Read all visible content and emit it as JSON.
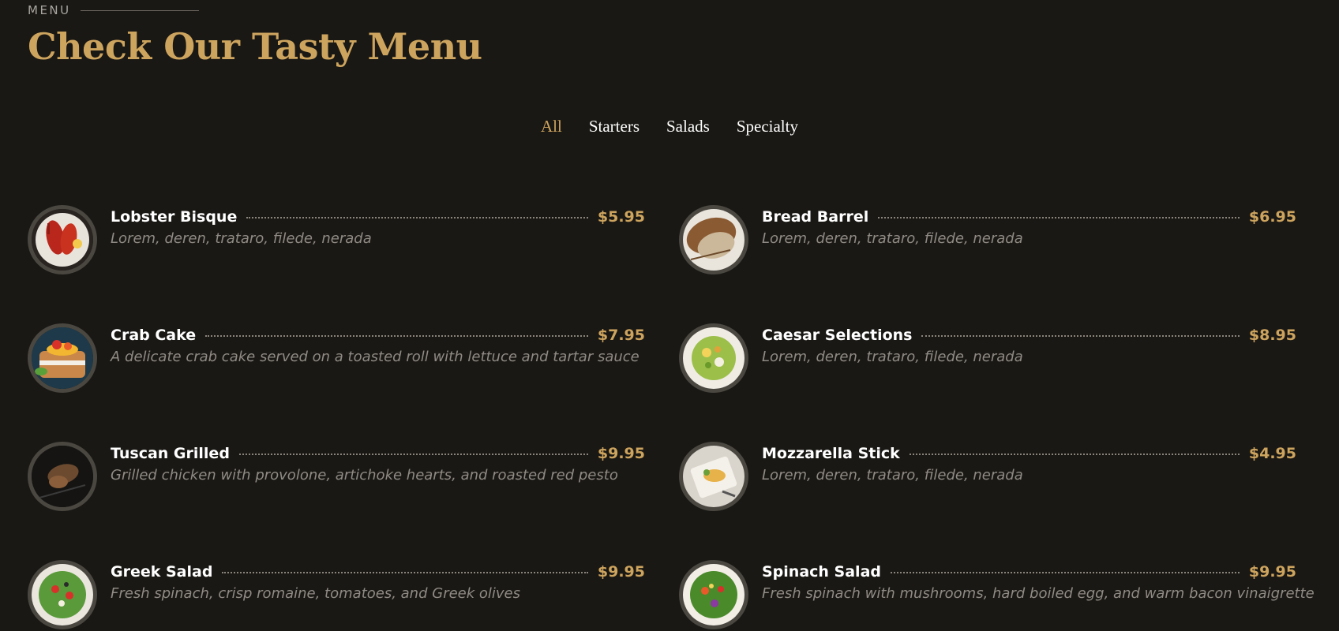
{
  "section": {
    "eyebrow": "MENU",
    "title": "Check Our Tasty Menu"
  },
  "filters": [
    {
      "label": "All",
      "active": true
    },
    {
      "label": "Starters",
      "active": false
    },
    {
      "label": "Salads",
      "active": false
    },
    {
      "label": "Specialty",
      "active": false
    }
  ],
  "items": [
    {
      "name": "Lobster Bisque",
      "price": "$5.95",
      "description": "Lorem, deren, trataro, filede, nerada",
      "image": "lobster-bisque-image"
    },
    {
      "name": "Bread Barrel",
      "price": "$6.95",
      "description": "Lorem, deren, trataro, filede, nerada",
      "image": "bread-barrel-image"
    },
    {
      "name": "Crab Cake",
      "price": "$7.95",
      "description": "A delicate crab cake served on a toasted roll with lettuce and tartar sauce",
      "image": "crab-cake-image"
    },
    {
      "name": "Caesar Selections",
      "price": "$8.95",
      "description": "Lorem, deren, trataro, filede, nerada",
      "image": "caesar-selections-image"
    },
    {
      "name": "Tuscan Grilled",
      "price": "$9.95",
      "description": "Grilled chicken with provolone, artichoke hearts, and roasted red pesto",
      "image": "tuscan-grilled-image"
    },
    {
      "name": "Mozzarella Stick",
      "price": "$4.95",
      "description": "Lorem, deren, trataro, filede, nerada",
      "image": "mozzarella-stick-image"
    },
    {
      "name": "Greek Salad",
      "price": "$9.95",
      "description": "Fresh spinach, crisp romaine, tomatoes, and Greek olives",
      "image": "greek-salad-image"
    },
    {
      "name": "Spinach Salad",
      "price": "$9.95",
      "description": "Fresh spinach with mushrooms, hard boiled egg, and warm bacon vinaigrette",
      "image": "spinach-salad-image"
    }
  ],
  "colors": {
    "background": "#1a1814",
    "accent": "#cda45e",
    "text": "#ffffff",
    "muted": "#8f8a84"
  }
}
